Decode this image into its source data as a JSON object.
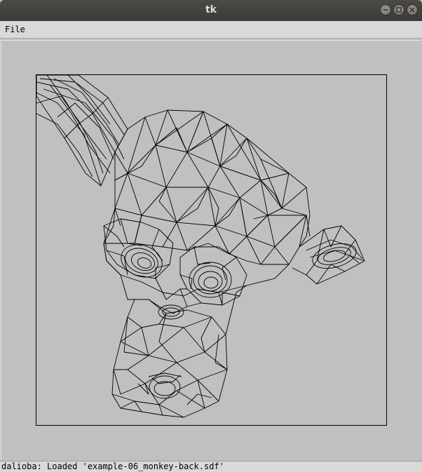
{
  "window": {
    "title": "tk"
  },
  "menubar": {
    "items": [
      {
        "label": "File"
      }
    ]
  },
  "statusbar": {
    "text": "dalioba: Loaded 'example-06_monkey-back.sdf'"
  },
  "icons": {
    "minimize": "minimize-icon",
    "maximize": "maximize-icon",
    "close": "close-icon"
  },
  "colors": {
    "background": "#c0c0c0",
    "wireframe": "#000000",
    "titlebar": "#3c3b37"
  }
}
